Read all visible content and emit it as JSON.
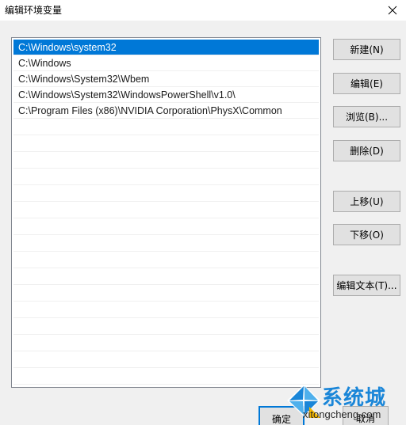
{
  "window": {
    "title": "编辑环境变量"
  },
  "list": {
    "items": [
      {
        "text": "C:\\Windows\\system32",
        "selected": true
      },
      {
        "text": "C:\\Windows",
        "selected": false
      },
      {
        "text": "C:\\Windows\\System32\\Wbem",
        "selected": false
      },
      {
        "text": "C:\\Windows\\System32\\WindowsPowerShell\\v1.0\\",
        "selected": false
      },
      {
        "text": "C:\\Program Files (x86)\\NVIDIA Corporation\\PhysX\\Common",
        "selected": false
      }
    ],
    "empty_rows": 16
  },
  "buttons": {
    "new": "新建(N)",
    "edit": "编辑(E)",
    "browse": "浏览(B)...",
    "delete": "删除(D)",
    "move_up": "上移(U)",
    "move_down": "下移(O)",
    "edit_text": "编辑文本(T)..."
  },
  "footer": {
    "ok": "确定",
    "cancel": "取消"
  },
  "watermark": {
    "brand": "系统城",
    "url": "xitongcheng.com"
  },
  "colors": {
    "selection": "#0078d7",
    "watermark_blue": "#1a86d8"
  }
}
